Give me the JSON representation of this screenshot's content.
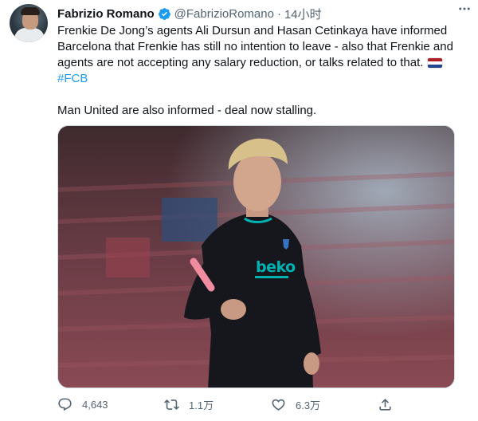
{
  "author": {
    "display_name": "Fabrizio Romano",
    "handle": "@FabrizioRomano",
    "separator": "·",
    "time": "14小时"
  },
  "tweet": {
    "line1": "Frenkie De Jong’s agents Ali Dursun and Hasan Cetinkaya have informed",
    "line2": "Barcelona that Frenkie has still no intention to leave - also that Frenkie and",
    "line3": "agents are not accepting any salary reduction, or talks related to that.",
    "hashtag": "#FCB",
    "paragraph2": "Man United are also informed - deal now stalling."
  },
  "media": {
    "kit_sponsor": "beko"
  },
  "actions": {
    "replies": "4,643",
    "retweets": "1.1万",
    "likes": "6.3万"
  },
  "colors": {
    "accent": "#1d9bf0",
    "muted": "#536471",
    "flag_red": "#ae1c28",
    "flag_blue": "#21468b",
    "kit_teal": "#00b3b3",
    "kit_pink": "#f08ca0"
  },
  "icons": {
    "verified": "verified-badge-icon",
    "more": "more-dots-icon",
    "reply": "reply-icon",
    "retweet": "retweet-icon",
    "like": "heart-icon",
    "share": "share-icon"
  }
}
